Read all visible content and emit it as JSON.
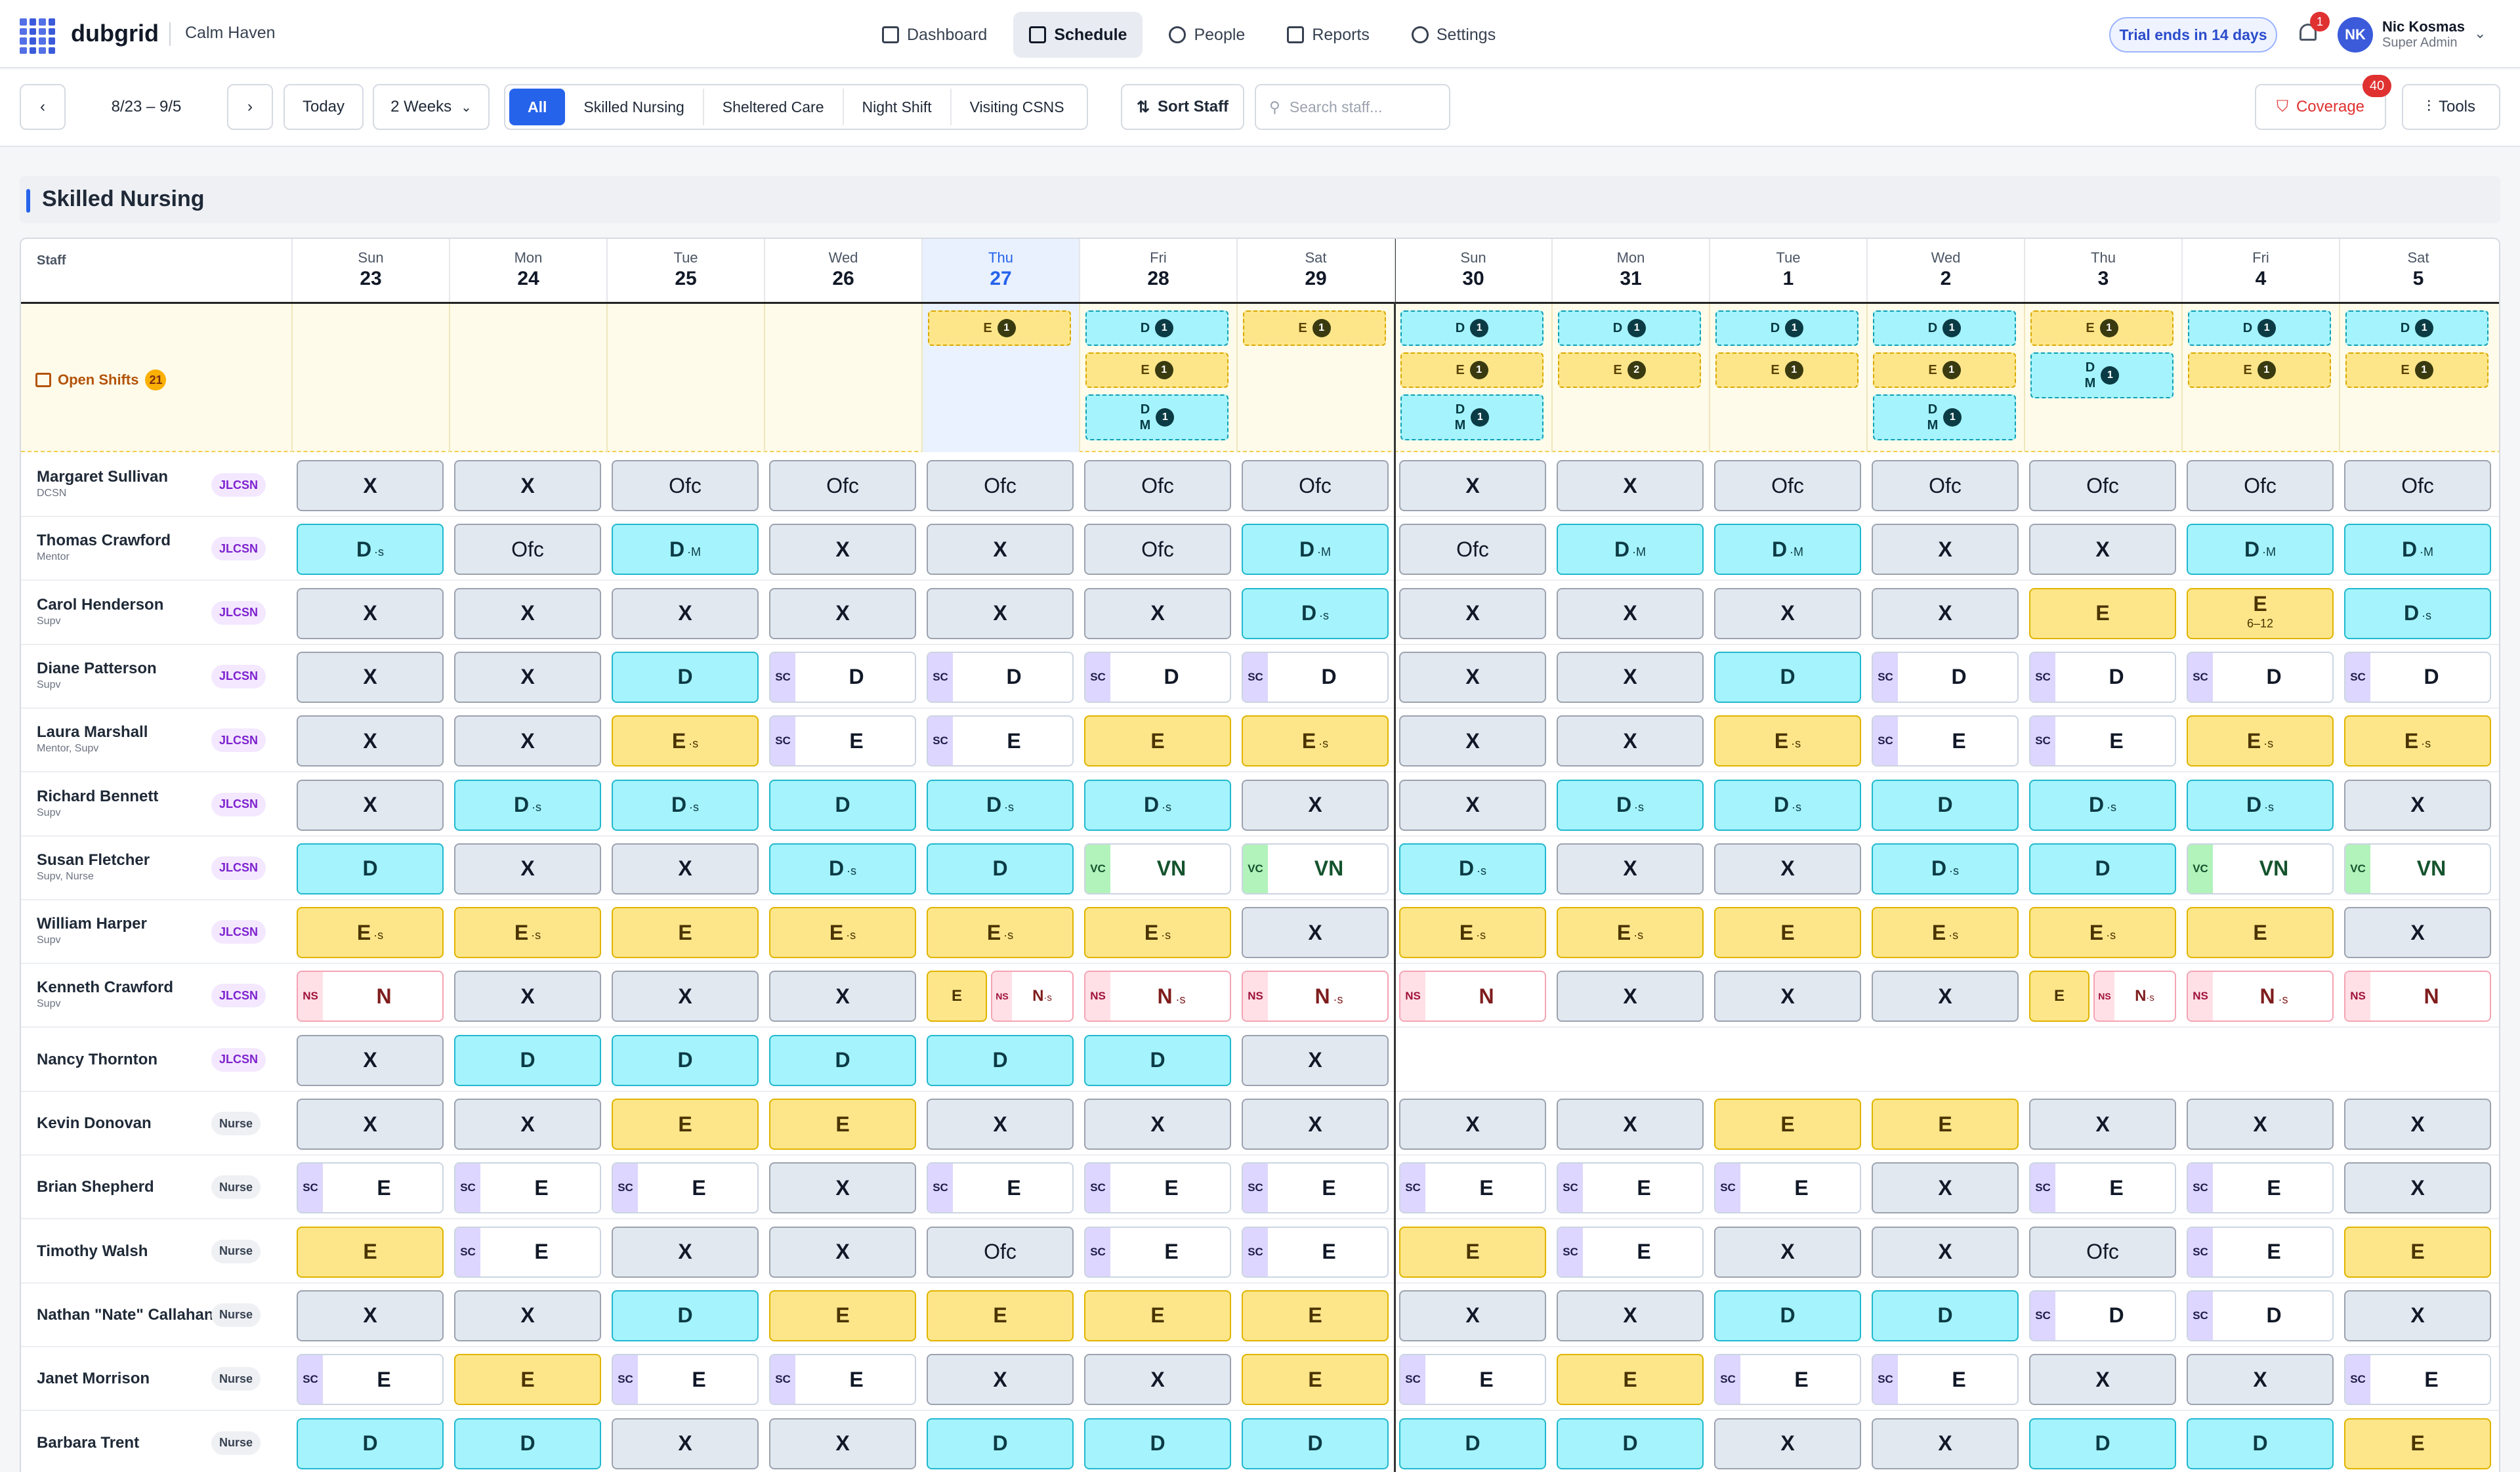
{
  "app": {
    "name": "dubgrid",
    "org": "Calm Haven"
  },
  "nav": [
    {
      "label": "Dashboard",
      "icon": "dashboard-icon"
    },
    {
      "label": "Schedule",
      "icon": "calendar-icon",
      "active": true
    },
    {
      "label": "People",
      "icon": "people-icon"
    },
    {
      "label": "Reports",
      "icon": "reports-icon"
    },
    {
      "label": "Settings",
      "icon": "gear-icon"
    }
  ],
  "trial": "Trial ends in 14 days",
  "notifications": {
    "count": "1"
  },
  "user": {
    "initials": "NK",
    "name": "Nic Kosmas",
    "role": "Super Admin"
  },
  "toolbar": {
    "range": "8/23 – 9/5",
    "today": "Today",
    "view": "2 Weeks",
    "filters": [
      "All",
      "Skilled Nursing",
      "Sheltered Care",
      "Night Shift",
      "Visiting CSNS"
    ],
    "active_filter": "All",
    "sort": "Sort Staff",
    "search_placeholder": "Search staff...",
    "coverage": "Coverage",
    "coverage_count": "40",
    "tools": "Tools"
  },
  "section": {
    "title": "Skilled Nursing",
    "staff_header": "Staff",
    "open_shifts_label": "Open Shifts",
    "open_shifts_count": "21"
  },
  "days": [
    {
      "name": "Sun",
      "num": "23"
    },
    {
      "name": "Mon",
      "num": "24"
    },
    {
      "name": "Tue",
      "num": "25"
    },
    {
      "name": "Wed",
      "num": "26"
    },
    {
      "name": "Thu",
      "num": "27",
      "today": true
    },
    {
      "name": "Fri",
      "num": "28"
    },
    {
      "name": "Sat",
      "num": "29"
    },
    {
      "name": "Sun",
      "num": "30"
    },
    {
      "name": "Mon",
      "num": "31"
    },
    {
      "name": "Tue",
      "num": "1"
    },
    {
      "name": "Wed",
      "num": "2"
    },
    {
      "name": "Thu",
      "num": "3"
    },
    {
      "name": "Fri",
      "num": "4"
    },
    {
      "name": "Sat",
      "num": "5"
    }
  ],
  "open_shifts": [
    [],
    [],
    [],
    [],
    [
      {
        "s": "E",
        "n": "1"
      }
    ],
    [
      {
        "s": "D",
        "n": "1"
      },
      {
        "s": "E",
        "n": "1"
      },
      {
        "s": "DM",
        "n": "1"
      }
    ],
    [
      {
        "s": "E",
        "n": "1"
      }
    ],
    [
      {
        "s": "D",
        "n": "1"
      },
      {
        "s": "E",
        "n": "1"
      },
      {
        "s": "DM",
        "n": "1"
      }
    ],
    [
      {
        "s": "D",
        "n": "1"
      },
      {
        "s": "E",
        "n": "2"
      }
    ],
    [
      {
        "s": "D",
        "n": "1"
      },
      {
        "s": "E",
        "n": "1"
      }
    ],
    [
      {
        "s": "D",
        "n": "1"
      },
      {
        "s": "E",
        "n": "1"
      },
      {
        "s": "DM",
        "n": "1"
      }
    ],
    [
      {
        "s": "E",
        "n": "1"
      },
      {
        "s": "DM",
        "n": "1"
      }
    ],
    [
      {
        "s": "D",
        "n": "1"
      },
      {
        "s": "E",
        "n": "1"
      }
    ],
    [
      {
        "s": "D",
        "n": "1"
      },
      {
        "s": "E",
        "n": "1"
      }
    ]
  ],
  "staff": [
    {
      "name": "Margaret Sullivan",
      "sub": "DCSN",
      "badge": "JLCSN",
      "shifts": [
        "X",
        "X",
        "Ofc",
        "Ofc",
        "Ofc",
        "Ofc",
        "Ofc",
        "X",
        "X",
        "Ofc",
        "Ofc",
        "Ofc",
        "Ofc",
        "Ofc"
      ]
    },
    {
      "name": "Thomas Crawford",
      "sub": "Mentor",
      "badge": "JLCSN",
      "shifts": [
        "D·s",
        "Ofc",
        "D·M",
        "X",
        "X",
        "Ofc",
        "D·M",
        "Ofc",
        "D·M",
        "D·M",
        "X",
        "X",
        "D·M",
        "D·M"
      ]
    },
    {
      "name": "Carol Henderson",
      "sub": "Supv",
      "badge": "JLCSN",
      "shifts": [
        "X",
        "X",
        "X",
        "X",
        "X",
        "X",
        "D·s",
        "X",
        "X",
        "X",
        "X",
        "E",
        "E|6–12",
        "D·s"
      ]
    },
    {
      "name": "Diane Patterson",
      "sub": "Supv",
      "badge": "JLCSN",
      "shifts": [
        "X",
        "X",
        "D",
        "SC:D",
        "SC:D",
        "SC:D",
        "SC:D",
        "X",
        "X",
        "D",
        "SC:D",
        "SC:D",
        "SC:D",
        "SC:D"
      ]
    },
    {
      "name": "Laura Marshall",
      "sub": "Mentor, Supv",
      "badge": "JLCSN",
      "shifts": [
        "X",
        "X",
        "E·s",
        "SC:E",
        "SC:E",
        "E",
        "E·s",
        "X",
        "X",
        "E·s",
        "SC:E",
        "SC:E",
        "E·s",
        "E·s"
      ]
    },
    {
      "name": "Richard Bennett",
      "sub": "Supv",
      "badge": "JLCSN",
      "shifts": [
        "X",
        "D·s",
        "D·s",
        "D",
        "D·s",
        "D·s",
        "X",
        "X",
        "D·s",
        "D·s",
        "D",
        "D·s",
        "D·s",
        "X"
      ]
    },
    {
      "name": "Susan Fletcher",
      "sub": "Supv, Nurse",
      "badge": "JLCSN",
      "shifts": [
        "D",
        "X",
        "X",
        "D·s",
        "D",
        "VC:VN",
        "VC:VN",
        "D·s",
        "X",
        "X",
        "D·s",
        "D",
        "VC:VN",
        "VC:VN"
      ]
    },
    {
      "name": "William Harper",
      "sub": "Supv",
      "badge": "JLCSN",
      "shifts": [
        "E·s",
        "E·s",
        "E",
        "E·s",
        "E·s",
        "E·s",
        "X",
        "E·s",
        "E·s",
        "E",
        "E·s",
        "E·s",
        "E",
        "X"
      ]
    },
    {
      "name": "Kenneth Crawford",
      "sub": "Supv",
      "badge": "JLCSN",
      "shifts": [
        "NS:N",
        "X",
        "X",
        "X",
        "E+NS:N·s",
        "NS:N·s",
        "NS:N·s",
        "NS:N",
        "X",
        "X",
        "X",
        "E+NS:N·s",
        "NS:N·s",
        "NS:N"
      ]
    },
    {
      "name": "Nancy Thornton",
      "sub": "",
      "badge": "JLCSN",
      "shifts": [
        "X",
        "D",
        "D",
        "D",
        "D",
        "D",
        "X",
        "",
        "",
        "",
        "",
        "",
        "",
        ""
      ]
    },
    {
      "name": "Kevin Donovan",
      "sub": "",
      "badge": "Nurse",
      "shifts": [
        "X",
        "X",
        "E",
        "E",
        "X",
        "X",
        "X",
        "X",
        "X",
        "E",
        "E",
        "X",
        "X",
        "X"
      ]
    },
    {
      "name": "Brian Shepherd",
      "sub": "",
      "badge": "Nurse",
      "shifts": [
        "SC:E",
        "SC:E",
        "SC:E",
        "X",
        "SC:E",
        "SC:E",
        "SC:E",
        "SC:E",
        "SC:E",
        "SC:E",
        "X",
        "SC:E",
        "SC:E",
        "X"
      ]
    },
    {
      "name": "Timothy Walsh",
      "sub": "",
      "badge": "Nurse",
      "shifts": [
        "E",
        "SC:E",
        "X",
        "X",
        "Ofc",
        "SC:E",
        "SC:E",
        "E",
        "SC:E",
        "X",
        "X",
        "Ofc",
        "SC:E",
        "E"
      ]
    },
    {
      "name": "Nathan \"Nate\" Callahan",
      "sub": "",
      "badge": "Nurse",
      "shifts": [
        "X",
        "X",
        "D",
        "E",
        "E",
        "E",
        "E",
        "X",
        "X",
        "D",
        "D",
        "SC:D",
        "SC:D",
        "X"
      ]
    },
    {
      "name": "Janet Morrison",
      "sub": "",
      "badge": "Nurse",
      "shifts": [
        "SC:E",
        "E",
        "SC:E",
        "SC:E",
        "X",
        "X",
        "E",
        "SC:E",
        "E",
        "SC:E",
        "SC:E",
        "X",
        "X",
        "SC:E"
      ]
    },
    {
      "name": "Barbara Trent",
      "sub": "",
      "badge": "Nurse",
      "shifts": [
        "D",
        "D",
        "X",
        "X",
        "D",
        "D",
        "D",
        "D",
        "D",
        "X",
        "X",
        "D",
        "D",
        "E"
      ]
    }
  ]
}
